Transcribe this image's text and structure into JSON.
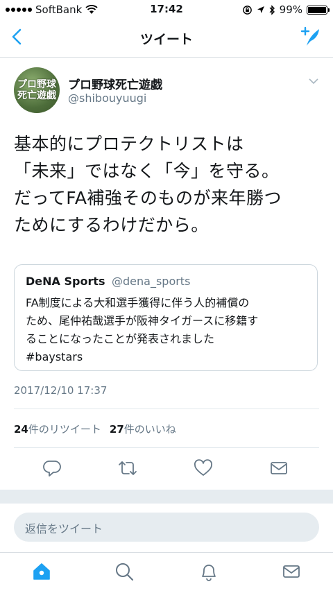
{
  "status": {
    "carrier": "SoftBank",
    "time": "17:42",
    "battery": "99%",
    "battery_level": 0.99
  },
  "nav": {
    "title": "ツイート"
  },
  "tweet": {
    "avatar_lines": [
      "プロ野球",
      "死亡遊戯"
    ],
    "display_name": "プロ野球死亡遊戯",
    "handle": "@shibouyuugi",
    "text_lines": [
      "基本的にプロテクトリストは",
      "「未来」ではなく「今」を守る。",
      "だってFA補強そのものが来年勝つ",
      "ためにするわけだから。"
    ],
    "timestamp": "2017/12/10 17:37",
    "retweets": "24",
    "retweets_label": "件のリツイート",
    "likes": "27",
    "likes_label": "件のいいね"
  },
  "quote": {
    "name": "DeNA Sports",
    "handle": "@dena_sports",
    "text_lines": [
      "FA制度による大和選手獲得に伴う人的補償の",
      "ため、尾仲祐哉選手が阪神タイガースに移籍す",
      "ることになったことが発表されました",
      "#baystars"
    ]
  },
  "reply": {
    "placeholder": "返信をツイート"
  },
  "colors": {
    "accent": "#1da1f2",
    "text": "#14171a",
    "muted": "#657786",
    "divider": "#e1e8ed"
  },
  "icons": [
    "back-chevron-icon",
    "compose-tweet-icon",
    "reply-icon",
    "retweet-icon",
    "like-icon",
    "dm-icon",
    "home-icon",
    "search-icon",
    "notifications-icon",
    "messages-icon"
  ]
}
